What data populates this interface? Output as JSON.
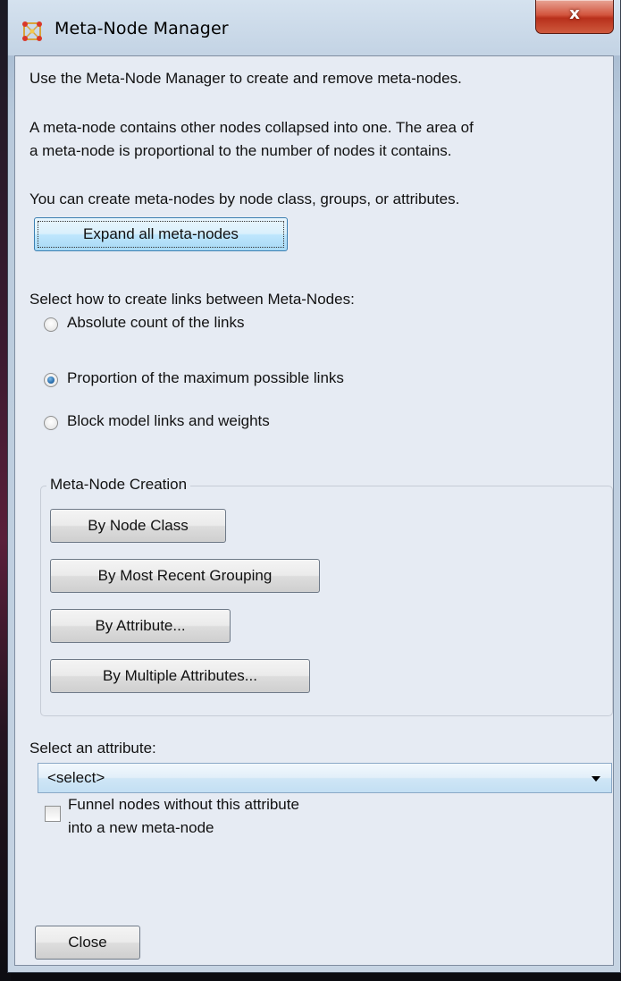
{
  "window": {
    "title": "Meta-Node Manager",
    "close_symbol": "x"
  },
  "intro": {
    "line1": "Use the Meta-Node Manager to create and remove meta-nodes.",
    "line2a": "A meta-node contains other nodes collapsed into one. The area of",
    "line2b": "a meta-node is proportional to the number of nodes it contains.",
    "line3": "You can create meta-nodes by node class, groups, or attributes."
  },
  "expand_button": "Expand all meta-nodes",
  "links": {
    "heading": "Select how to create links between Meta-Nodes:",
    "options": [
      {
        "label": "Absolute count of the links",
        "checked": false
      },
      {
        "label": "Proportion of the maximum possible links",
        "checked": true
      },
      {
        "label": "Block model links and weights",
        "checked": false
      }
    ]
  },
  "creation": {
    "title": "Meta-Node Creation",
    "buttons": [
      "By Node Class",
      "By Most Recent Grouping",
      "By Attribute...",
      "By Multiple Attributes..."
    ]
  },
  "attribute": {
    "label": "Select an attribute:",
    "selected": "<select>"
  },
  "funnel": {
    "line1": "Funnel nodes without this attribute",
    "line2": "into a new meta-node",
    "checked": false
  },
  "close_button": "Close",
  "colors": {
    "accent": "#3c7fb1",
    "close_red": "#c8412a",
    "panel": "#e6ebf3"
  }
}
